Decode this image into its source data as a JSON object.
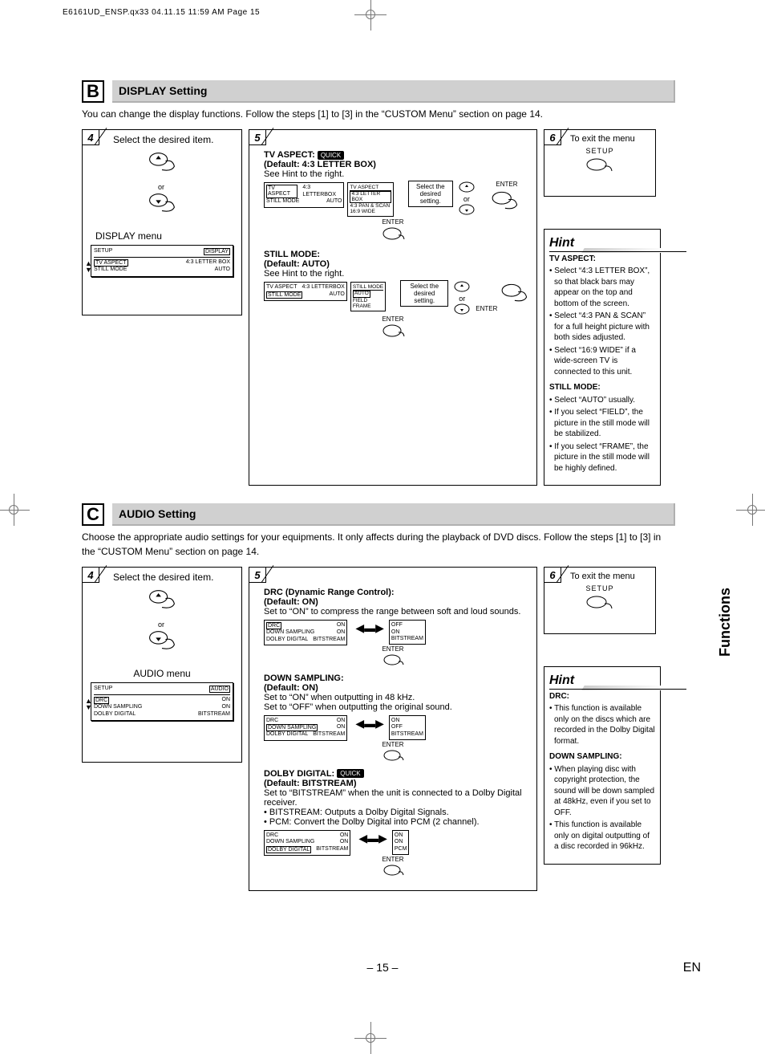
{
  "meta": {
    "jobline": "E6161UD_ENSP.qx33  04.11.15 11:59 AM  Page 15"
  },
  "sectionB": {
    "letter": "B",
    "title": "DISPLAY Setting",
    "desc": "You can change the display functions. Follow the steps [1] to [3] in the “CUSTOM Menu” section on page 14.",
    "step4": {
      "num": "4",
      "head": "Select the desired item.",
      "or": "or",
      "menuLabel": "DISPLAY menu",
      "osd": {
        "top": {
          "l": "SETUP",
          "r": "DISPLAY"
        },
        "rows": [
          {
            "l": "TV ASPECT",
            "r": "4:3 LETTER BOX",
            "lhl": true
          },
          {
            "l": "STILL MODE",
            "r": "AUTO"
          }
        ]
      }
    },
    "step5": {
      "num": "5",
      "tvaspect": {
        "title": "TV ASPECT:",
        "quick": "QUICK",
        "def": "(Default: 4:3 LETTER BOX)",
        "see": "See Hint to the right.",
        "panel": {
          "rows": [
            {
              "l": "TV ASPECT",
              "r": "4:3 LETTERBOX",
              "lhl": true
            },
            {
              "l": "STILL MODE",
              "r": "AUTO"
            }
          ]
        },
        "list": {
          "title": "TV ASPECT",
          "items": [
            "4:3 LETTER BOX",
            "4:3 PAN & SCAN",
            "16:9 WIDE"
          ]
        },
        "selbox": "Select the desired setting.",
        "enter": "ENTER"
      },
      "still": {
        "title": "STILL MODE:",
        "def": "(Default: AUTO)",
        "see": "See Hint to the right.",
        "panel": {
          "rows": [
            {
              "l": "TV ASPECT",
              "r": "4:3 LETTERBOX"
            },
            {
              "l": "STILL MODE",
              "r": "AUTO",
              "lhl": true
            }
          ]
        },
        "list": {
          "title": "STILL MODE",
          "items": [
            "AUTO",
            "FIELD",
            "FRAME"
          ]
        },
        "selbox": "Select the desired setting.",
        "enter": "ENTER"
      },
      "enterFoot": "ENTER",
      "or": "or"
    },
    "step6": {
      "num": "6",
      "head": "To exit the menu",
      "setup": "SETUP"
    },
    "hint": {
      "title": "Hint",
      "h1": "TV ASPECT:",
      "b1": [
        "Select “4:3 LETTER BOX”, so that black bars may appear on the top and bottom of the screen.",
        "Select “4:3 PAN & SCAN” for a full height picture with both sides adjusted.",
        "Select “16:9 WIDE” if a wide-screen TV is connected to this unit."
      ],
      "h2": "STILL MODE:",
      "b2": [
        "Select “AUTO” usually.",
        "If you select “FIELD”, the picture in the still mode will be stabilized.",
        "If you select “FRAME”, the picture in the still mode will be highly defined."
      ]
    }
  },
  "sectionC": {
    "letter": "C",
    "title": "AUDIO Setting",
    "desc": "Choose the appropriate audio settings for your equipments. It only affects during the playback of DVD discs. Follow the steps [1] to [3] in the “CUSTOM Menu” section on page 14.",
    "step4": {
      "num": "4",
      "head": "Select the desired item.",
      "or": "or",
      "menuLabel": "AUDIO menu",
      "osd": {
        "top": {
          "l": "SETUP",
          "r": "AUDIO"
        },
        "rows": [
          {
            "l": "DRC",
            "r": "ON",
            "lhl": true
          },
          {
            "l": "DOWN SAMPLING",
            "r": "ON"
          },
          {
            "l": "DOLBY DIGITAL",
            "r": "BITSTREAM"
          }
        ]
      }
    },
    "step5": {
      "num": "5",
      "drc": {
        "title": "DRC (Dynamic Range Control):",
        "def": "(Default: ON)",
        "see": "Set to “ON” to compress the range between soft and loud sounds.",
        "panel": {
          "rows": [
            {
              "l": "DRC",
              "r": "ON",
              "lhl": true,
              "r2": "OFF"
            },
            {
              "l": "DOWN SAMPLING",
              "r": "ON",
              "r2": "ON"
            },
            {
              "l": "DOLBY DIGITAL",
              "r": "BITSTREAM",
              "r2": "BITSTREAM"
            }
          ]
        },
        "enter": "ENTER"
      },
      "ds": {
        "title": "DOWN SAMPLING:",
        "def": "(Default: ON)",
        "see1": "Set to “ON” when outputting in 48 kHz.",
        "see2": "Set to “OFF” when outputting the original sound.",
        "panel": {
          "rows": [
            {
              "l": "DRC",
              "r": "ON",
              "r2": "ON"
            },
            {
              "l": "DOWN SAMPLING",
              "r": "ON",
              "lhl": true,
              "r2": "OFF"
            },
            {
              "l": "DOLBY DIGITAL",
              "r": "BITSTREAM",
              "r2": "BITSTREAM"
            }
          ]
        },
        "enter": "ENTER"
      },
      "dd": {
        "title": "DOLBY DIGITAL:",
        "quick": "QUICK",
        "def": "(Default: BITSTREAM)",
        "l1": "Set to “BITSTREAM” when the unit is connected to a Dolby Digital receiver.",
        "l2": "• BITSTREAM: Outputs a Dolby Digital Signals.",
        "l3": "• PCM: Convert the Dolby Digital into PCM (2 channel).",
        "panel": {
          "rows": [
            {
              "l": "DRC",
              "r": "ON",
              "r2": "ON"
            },
            {
              "l": "DOWN SAMPLING",
              "r": "ON",
              "r2": "ON"
            },
            {
              "l": "DOLBY DIGITAL",
              "r": "BITSTREAM",
              "lhl": true,
              "r2": "PCM"
            }
          ]
        },
        "enter": "ENTER"
      }
    },
    "step6": {
      "num": "6",
      "head": "To exit the menu",
      "setup": "SETUP"
    },
    "hint": {
      "title": "Hint",
      "h1": "DRC:",
      "b1": [
        "This function is available only on the discs which are recorded in the Dolby Digital format."
      ],
      "h2": "DOWN SAMPLING:",
      "b2": [
        "When playing disc with copyright protection, the sound will be down sampled at 48kHz, even if you set to OFF.",
        "This function is available only on digital outputting of a disc recorded in 96kHz."
      ]
    }
  },
  "sideTab": "Functions",
  "footer": {
    "page": "– 15 –",
    "lang": "EN"
  }
}
